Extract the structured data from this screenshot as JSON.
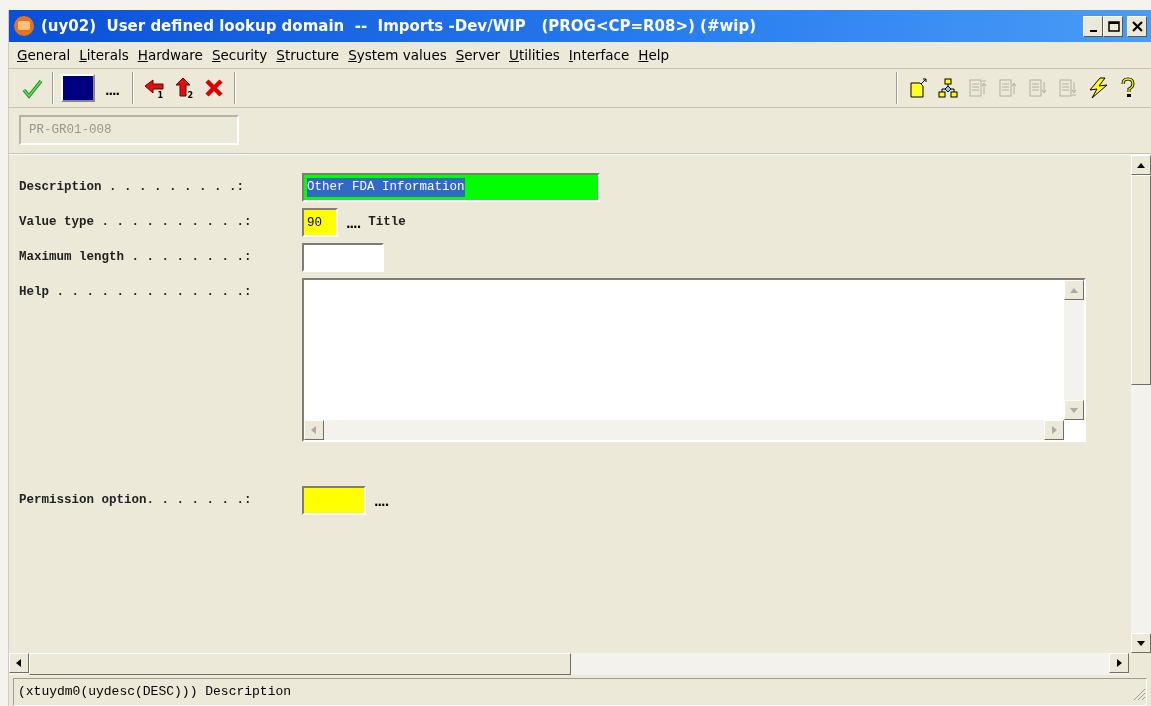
{
  "window": {
    "title": "(uy02)  User defined lookup domain  --  Imports -Dev/WIP   (PROG<CP=R08>) (#wip)"
  },
  "menu": [
    {
      "label": "General"
    },
    {
      "label": "Literals"
    },
    {
      "label": "Hardware"
    },
    {
      "label": "Security"
    },
    {
      "label": "Structure"
    },
    {
      "label": "System values"
    },
    {
      "label": "Server"
    },
    {
      "label": "Utilities"
    },
    {
      "label": "Interface"
    },
    {
      "label": "Help"
    }
  ],
  "toolbar_left": [
    {
      "kind": "check",
      "disabled": false
    },
    {
      "kind": "swatch",
      "disabled": false
    },
    {
      "kind": "ellipsis",
      "label": "....",
      "disabled": false
    },
    {
      "kind": "back",
      "badge": "1",
      "disabled": false
    },
    {
      "kind": "up",
      "badge": "2",
      "disabled": false
    },
    {
      "kind": "delete",
      "disabled": false
    }
  ],
  "toolbar_right": [
    {
      "kind": "new",
      "disabled": false
    },
    {
      "kind": "tree",
      "disabled": false
    },
    {
      "kind": "top",
      "disabled": true
    },
    {
      "kind": "raise",
      "disabled": true
    },
    {
      "kind": "lower",
      "disabled": true
    },
    {
      "kind": "bottom",
      "disabled": true
    },
    {
      "kind": "run",
      "disabled": false
    },
    {
      "kind": "help",
      "disabled": false
    }
  ],
  "record": {
    "value": "PR-GR01-008",
    "disabled": true
  },
  "fields": [
    {
      "kind": "text",
      "label": "Description . . . . . . . . .:",
      "value": "Other FDA Information",
      "color": "#00ff00",
      "text_selected": true
    },
    {
      "kind": "code",
      "label": "Value type . . . . . . . . . .:",
      "value": "90",
      "color": "#ffff00",
      "lookup": "....",
      "caption": "Title"
    },
    {
      "kind": "number",
      "label": "Maximum length . . . . . . . .:",
      "color": "#ffffff"
    },
    {
      "kind": "memo",
      "label": "Help . . . . . . . . . . . . .:",
      "color": "#ffffff"
    },
    {
      "kind": "code",
      "label": "Permission option. . . . . . .:",
      "color": "#ffff00",
      "lookup": "...."
    }
  ],
  "status_bar": {
    "text": "(xtuydm0(uydesc(DESC))) Description"
  }
}
